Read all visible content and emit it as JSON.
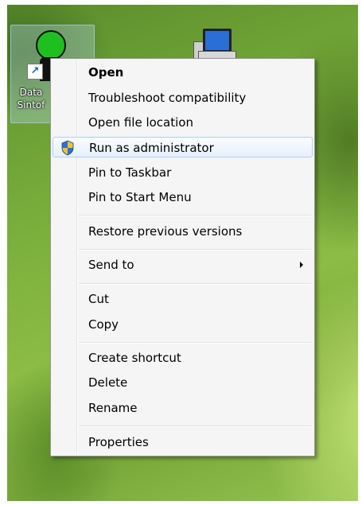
{
  "desktop": {
    "icons": [
      {
        "name": "data-sintofarm",
        "label_line1": "Data",
        "label_line2": "Sintof"
      },
      {
        "name": "computer"
      }
    ]
  },
  "context_menu": {
    "items": [
      {
        "label": "Open",
        "bold": true
      },
      {
        "label": "Troubleshoot compatibility"
      },
      {
        "label": "Open file location"
      },
      {
        "label": "Run as administrator",
        "icon": "shield-icon",
        "hovered": true
      },
      {
        "label": "Pin to Taskbar"
      },
      {
        "label": "Pin to Start Menu"
      },
      {
        "label": "Restore previous versions"
      },
      {
        "label": "Send to",
        "submenu": true
      },
      {
        "label": "Cut"
      },
      {
        "label": "Copy"
      },
      {
        "label": "Create shortcut"
      },
      {
        "label": "Delete"
      },
      {
        "label": "Rename"
      },
      {
        "label": "Properties"
      }
    ]
  },
  "colors": {
    "menu_background": "#f5f5f5",
    "menu_border": "#979797",
    "hover_border": "#aecff7",
    "shield_blue": "#2f6fd0",
    "shield_yellow": "#f2c230"
  }
}
